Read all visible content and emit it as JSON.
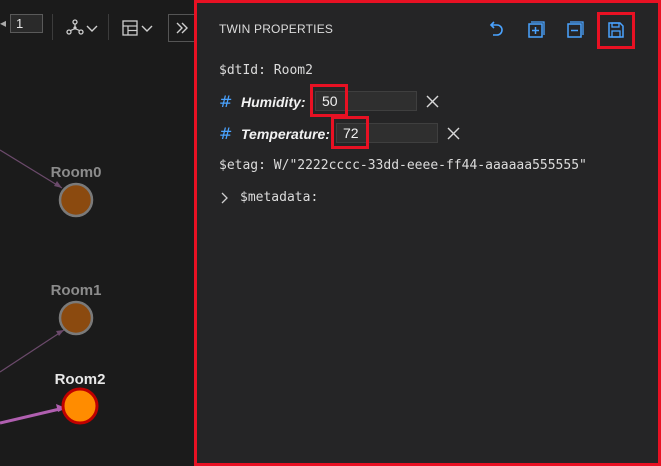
{
  "toolbar": {
    "page_number": "1",
    "layout_icon": "network-layout-icon",
    "view_icon": "table-view-icon",
    "more_icon": "chevron-double-right-icon"
  },
  "graph": {
    "nodes": [
      {
        "label": "Room0",
        "state": "default"
      },
      {
        "label": "Room1",
        "state": "default"
      },
      {
        "label": "Room2",
        "state": "selected"
      }
    ],
    "colors": {
      "node_fill": "#8b4a0f",
      "selected_fill": "#ff8c00",
      "selected_ring": "#c00000",
      "edge": "#6b4a6b",
      "selected_edge": "#b05fb0"
    }
  },
  "panel": {
    "title": "TWIN PROPERTIES",
    "icons": [
      "undo-icon",
      "expand-all-icon",
      "collapse-all-icon",
      "save-icon"
    ],
    "dtid_label": "$dtId:",
    "dtid_value": "Room2",
    "properties": [
      {
        "hash": "#",
        "name": "Humidity:",
        "value": "50"
      },
      {
        "hash": "#",
        "name": "Temperature:",
        "value": "72"
      }
    ],
    "etag_label": "$etag:",
    "etag_value": "W/\"2222cccc-33dd-eeee-ff44-aaaaaa555555\"",
    "metadata_label": "$metadata:",
    "accent_color": "#4aa3ff",
    "highlight_color": "#e81123"
  }
}
